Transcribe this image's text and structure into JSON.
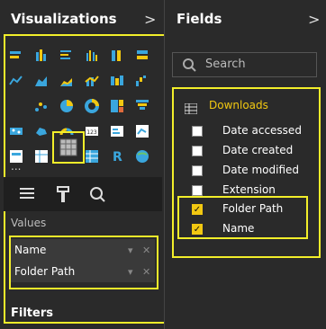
{
  "visualizations": {
    "title": "Visualizations",
    "expand_glyph": ">"
  },
  "fields": {
    "title": "Fields",
    "expand_glyph": ">",
    "search_placeholder": "Search",
    "table_name": "Downloads"
  },
  "field_items": [
    {
      "label": "Date accessed",
      "checked": false
    },
    {
      "label": "Date created",
      "checked": false
    },
    {
      "label": "Date modified",
      "checked": false
    },
    {
      "label": "Extension",
      "checked": false
    },
    {
      "label": "Folder Path",
      "checked": true
    },
    {
      "label": "Name",
      "checked": true
    }
  ],
  "values": {
    "label": "Values",
    "wells": [
      "Name",
      "Folder Path"
    ],
    "filters_label": "Filters"
  },
  "ellipsis": "...",
  "colors": {
    "accent": "#f2c811",
    "highlight_border": "#f2ee2a"
  }
}
